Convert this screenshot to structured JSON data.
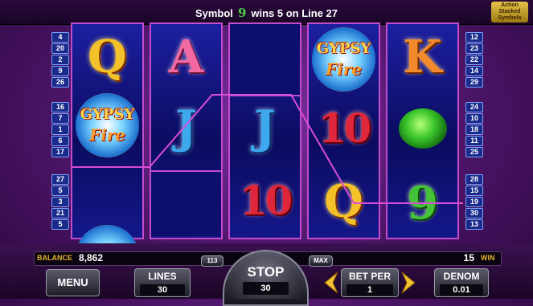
{
  "header": {
    "win_prefix": "Symbol",
    "win_symbol": "9",
    "win_suffix": "wins 5 on Line 27",
    "logo_text": "Action Stacked Symbols"
  },
  "paylines_left": [
    "4",
    "20",
    "2",
    "9",
    "26",
    "16",
    "7",
    "1",
    "6",
    "17",
    "27",
    "5",
    "3",
    "21",
    "5"
  ],
  "paylines_right": [
    "12",
    "23",
    "22",
    "14",
    "29",
    "24",
    "10",
    "18",
    "11",
    "25",
    "28",
    "15",
    "19",
    "30",
    "13"
  ],
  "reels": [
    [
      "Q",
      "GYPSY FIRE",
      "GYPSY FIRE"
    ],
    [
      "A",
      "J",
      ""
    ],
    [
      "",
      "J",
      "10"
    ],
    [
      "GYPSY FIRE",
      "10",
      "Q"
    ],
    [
      "K",
      "emerald",
      "9"
    ]
  ],
  "gypsy": {
    "line1": "GYPSY",
    "line2": "Fire"
  },
  "footer": {
    "balance_label": "BALANCE",
    "balance_value": "8,862",
    "win_value": "15",
    "win_label": "WIN",
    "menu": "MENU",
    "lines_label": "LINES",
    "lines_value": "30",
    "min_lines": "113",
    "max_label": "MAX",
    "stop_label": "STOP",
    "stop_value": "30",
    "betper_label": "BET PER",
    "betper_value": "1",
    "denom_label": "DENOM",
    "denom_value": "0.01"
  },
  "colors": {
    "frame": "#c34ccd",
    "line": "#d94cd8",
    "win_green": "#44c23a"
  }
}
